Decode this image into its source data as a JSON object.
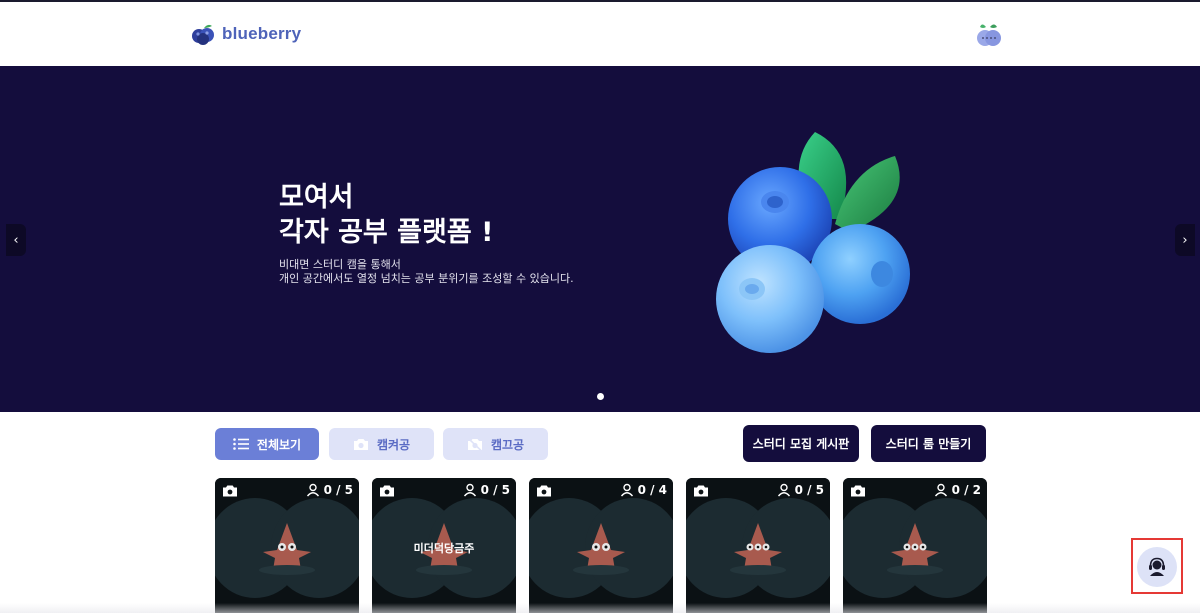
{
  "header": {
    "logo_text": "blueberry",
    "logo_icon": "blueberry-icon",
    "profile_icon": "blueberry-avatar-icon"
  },
  "hero": {
    "title_line1": "모여서",
    "title_line2": "각자 공부 플랫폼 !",
    "desc_line1": "비대면 스터디 캠을 통해서",
    "desc_line2": "개인 공간에서도 열정 넘치는 공부 분위기를 조성할 수 있습니다.",
    "prev_label": "‹",
    "next_label": "›",
    "slide_count": 1,
    "active_slide": 1
  },
  "filters": {
    "all_label": "전체보기",
    "cam_on_label": "캠켜공",
    "cam_off_label": "캠끄공",
    "active": "all"
  },
  "actions": {
    "recruit_board_label": "스터디 모집 게시판",
    "create_room_label": "스터디 룸 만들기"
  },
  "rooms": [
    {
      "title": "",
      "count": "0 / 5",
      "cam": true
    },
    {
      "title": "미더덕당금주",
      "count": "0 / 5",
      "cam": true
    },
    {
      "title": "",
      "count": "0 / 4",
      "cam": true
    },
    {
      "title": "",
      "count": "0 / 5",
      "cam": true
    },
    {
      "title": "",
      "count": "0 / 2",
      "cam": true
    }
  ],
  "colors": {
    "brand": "#4e63b9",
    "hero_bg": "#140d3d",
    "filter_active": "#6b7fd7",
    "filter_inactive": "#dfe3f8",
    "support_highlight": "#e53935"
  },
  "support": {
    "icon": "headset-support-icon"
  }
}
